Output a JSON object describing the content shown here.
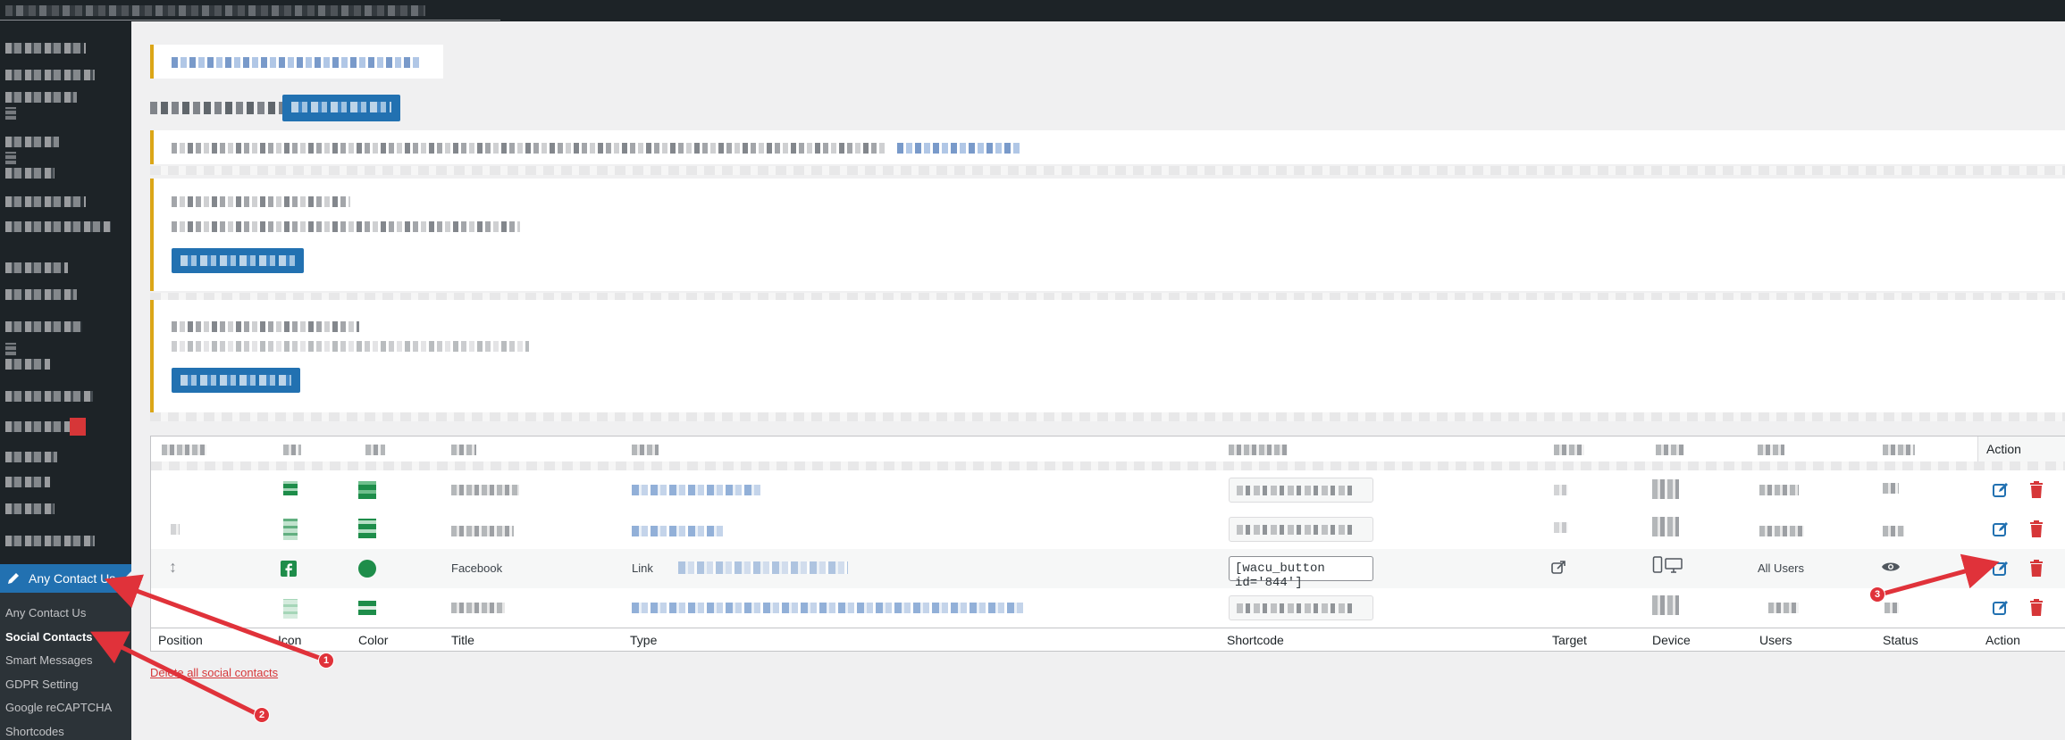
{
  "sidebar": {
    "active_menu": "Any Contact Us",
    "submenu": [
      "Any Contact Us",
      "Social Contacts",
      "Smart Messages",
      "GDPR Setting",
      "Google reCAPTCHA",
      "Shortcodes"
    ],
    "current_submenu_index": 1
  },
  "table": {
    "headers": [
      "Position",
      "Icon",
      "Color",
      "Title",
      "Type",
      "Shortcode",
      "Target",
      "Device",
      "Users",
      "Status",
      "Action"
    ],
    "top_action_label": "Action",
    "visible_row": {
      "title": "Facebook",
      "type": "Link",
      "shortcode": "[wacu_button id='844']",
      "users": "All Users",
      "color": "#1e8d4a",
      "icon_color": "#1e8d4a"
    }
  },
  "delete_all_link": "Delete all social contacts",
  "annotations": {
    "badges": [
      "1",
      "2",
      "3"
    ],
    "arrow_color": "#e0323a"
  },
  "icons": {
    "pencil": "pencil-icon",
    "edit": "edit-icon",
    "trash": "trash-icon",
    "drag": "drag-handle-icon",
    "external": "external-link-icon",
    "mobile": "mobile-icon",
    "desktop": "desktop-icon",
    "eye": "eye-icon",
    "facebook": "facebook-icon"
  }
}
